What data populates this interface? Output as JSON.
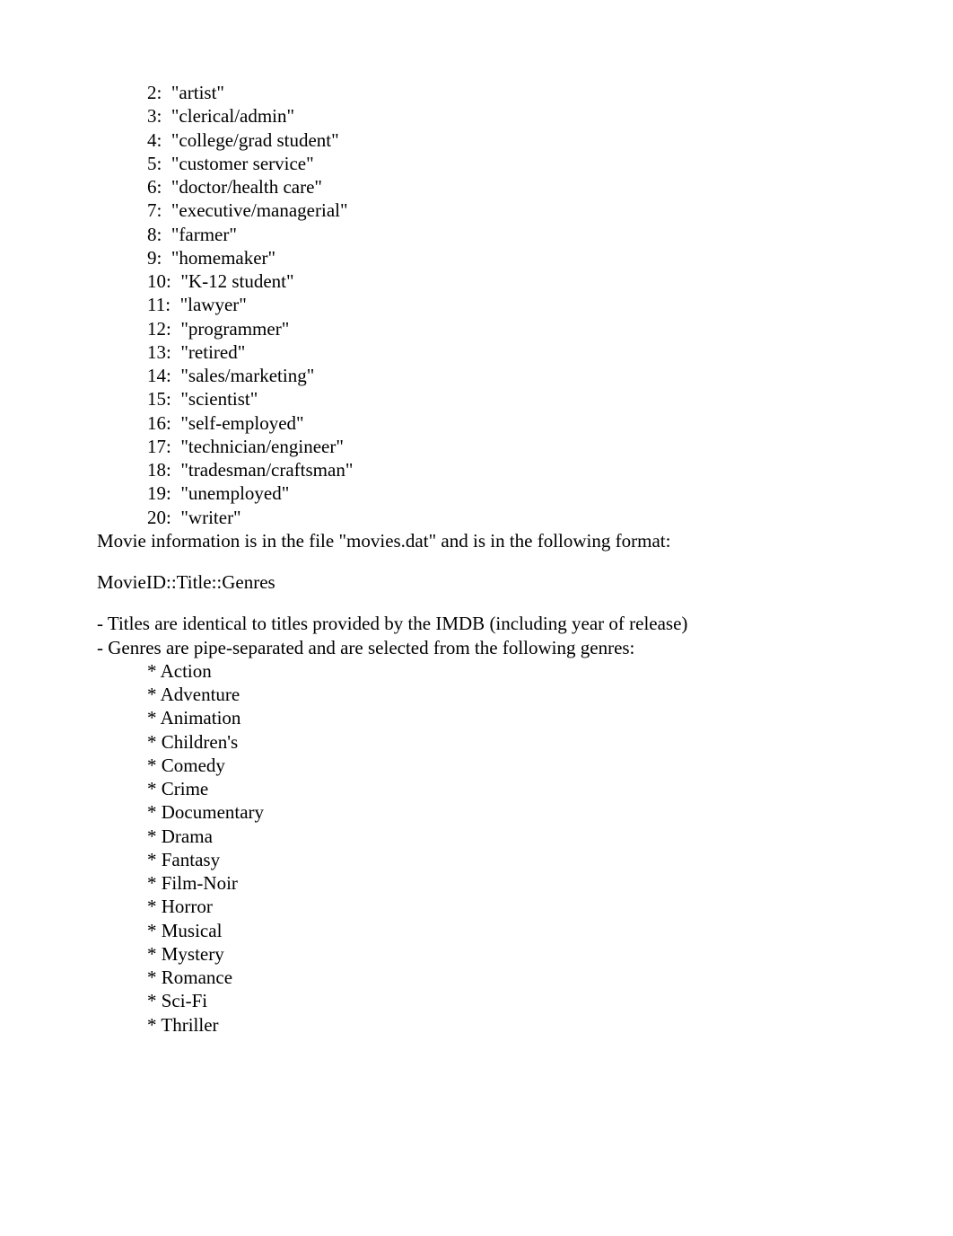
{
  "occupations": [
    {
      "key": "2",
      "label": "\"artist\""
    },
    {
      "key": "3",
      "label": "\"clerical/admin\""
    },
    {
      "key": "4",
      "label": "\"college/grad student\""
    },
    {
      "key": "5",
      "label": "\"customer service\""
    },
    {
      "key": "6",
      "label": "\"doctor/health care\""
    },
    {
      "key": "7",
      "label": "\"executive/managerial\""
    },
    {
      "key": "8",
      "label": "\"farmer\""
    },
    {
      "key": "9",
      "label": "\"homemaker\""
    },
    {
      "key": "10",
      "label": "\"K-12 student\""
    },
    {
      "key": "11",
      "label": "\"lawyer\""
    },
    {
      "key": "12",
      "label": "\"programmer\""
    },
    {
      "key": "13",
      "label": "\"retired\""
    },
    {
      "key": "14",
      "label": "\"sales/marketing\""
    },
    {
      "key": "15",
      "label": "\"scientist\""
    },
    {
      "key": "16",
      "label": "\"self-employed\""
    },
    {
      "key": "17",
      "label": "\"technician/engineer\""
    },
    {
      "key": "18",
      "label": "\"tradesman/craftsman\""
    },
    {
      "key": "19",
      "label": "\"unemployed\""
    },
    {
      "key": "20",
      "label": "\"writer\""
    }
  ],
  "movies_intro": "Movie information is in the file \"movies.dat\" and is in the following format:",
  "format_line": "MovieID::Title::Genres",
  "note_titles": "- Titles are identical to titles provided by the IMDB (including year of release)",
  "note_genres": "- Genres are pipe-separated and are selected from the following genres:",
  "genres": [
    "Action",
    "Adventure",
    "Animation",
    "Children's",
    "Comedy",
    "Crime",
    "Documentary",
    "Drama",
    "Fantasy",
    "Film-Noir",
    "Horror",
    "Musical",
    "Mystery",
    "Romance",
    "Sci-Fi",
    "Thriller"
  ]
}
